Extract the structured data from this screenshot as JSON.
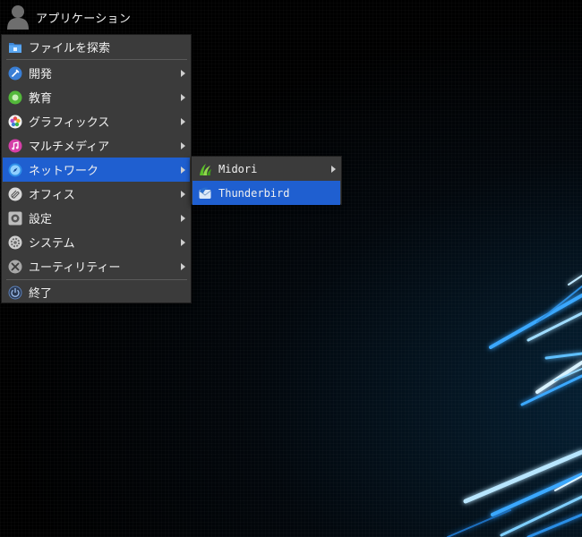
{
  "panel": {
    "title": "アプリケーション",
    "icon": "user-icon"
  },
  "menu": {
    "items": [
      {
        "label": "ファイルを探索",
        "icon": "folder-icon",
        "submenu": false
      },
      {
        "label": "開発",
        "icon": "development-icon",
        "submenu": true
      },
      {
        "label": "教育",
        "icon": "education-icon",
        "submenu": true
      },
      {
        "label": "グラフィックス",
        "icon": "graphics-icon",
        "submenu": true
      },
      {
        "label": "マルチメディア",
        "icon": "multimedia-icon",
        "submenu": true
      },
      {
        "label": "ネットワーク",
        "icon": "network-icon",
        "submenu": true,
        "selected": true
      },
      {
        "label": "オフィス",
        "icon": "office-icon",
        "submenu": true
      },
      {
        "label": "設定",
        "icon": "settings-icon",
        "submenu": true
      },
      {
        "label": "システム",
        "icon": "system-icon",
        "submenu": true
      },
      {
        "label": "ユーティリティー",
        "icon": "utilities-icon",
        "submenu": true
      },
      {
        "label": "終了",
        "icon": "logout-icon",
        "submenu": false
      }
    ]
  },
  "submenu": {
    "items": [
      {
        "label": "Midori",
        "icon": "midori-icon",
        "submenu": true
      },
      {
        "label": "Thunderbird",
        "icon": "thunderbird-icon",
        "submenu": false,
        "selected": true
      }
    ]
  },
  "colors": {
    "menu_background": "#3b3b3b",
    "selection": "#1f5fd0",
    "desktop_background": "#000000",
    "wallpaper_glow": "#49b8ff"
  }
}
